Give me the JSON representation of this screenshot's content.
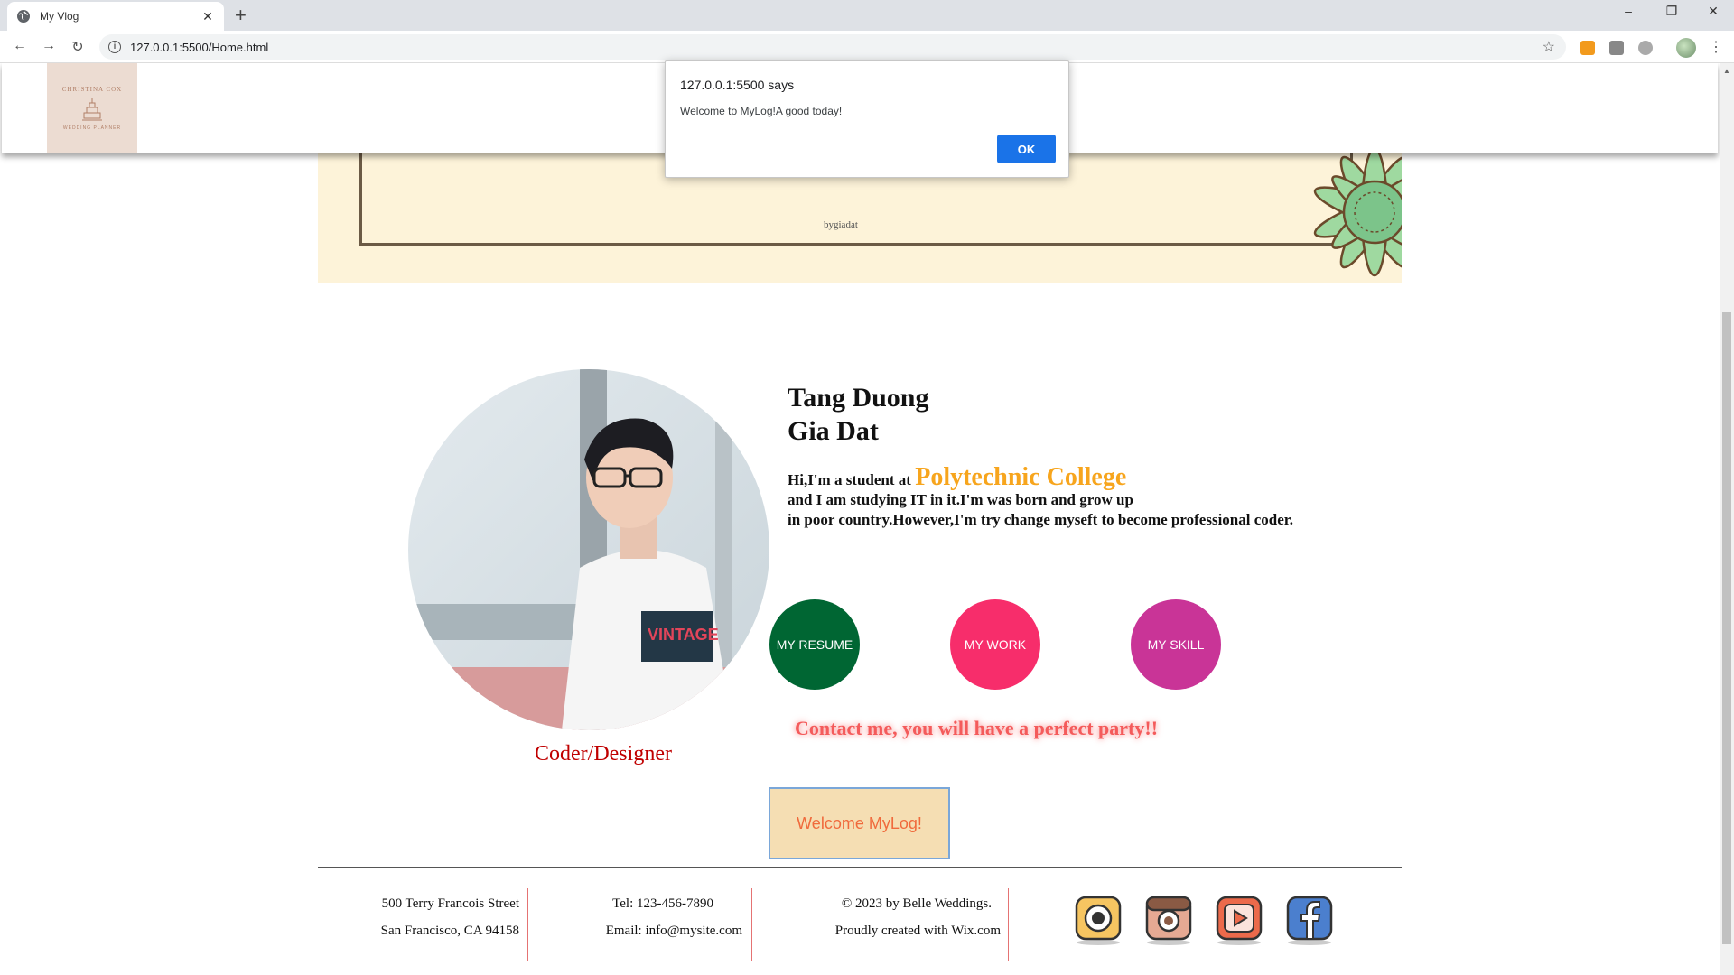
{
  "browser": {
    "tab_title": "My Vlog",
    "tab_close": "✕",
    "new_tab": "+",
    "url": "127.0.0.1:5500/Home.html",
    "window_controls": [
      "–",
      "❐",
      "✕"
    ]
  },
  "dialog": {
    "title": "127.0.0.1:5500 says",
    "message": "Welcome to MyLog!A good today!",
    "ok_label": "OK"
  },
  "header": {
    "logo": {
      "top": "CHRISTINA COX",
      "bottom": "WEDDING PLANNER"
    }
  },
  "banner": {
    "signature": "bygiadat"
  },
  "profile": {
    "name_line1": "Tang Duong",
    "name_line2": "Gia Dat",
    "role": "Coder/Designer",
    "bio_prefix": "Hi,I'm a student at ",
    "college": "Polytechnic College",
    "bio_line2": "and I am studying IT in it.I'm was born and grow up",
    "bio_line3": "in poor country.However,I'm try change myseft to become professional coder."
  },
  "buttons": [
    {
      "label": "MY RESUME",
      "color": "#006633"
    },
    {
      "label": "MY WORK",
      "color": "#f72d6b"
    },
    {
      "label": "MY SKILL",
      "color": "#c93497"
    }
  ],
  "contact_text": "Contact me, you will have a perfect party!!",
  "welcome_button": "Welcome MyLog!",
  "footer": {
    "address_line1": "500 Terry Francois Street",
    "address_line2": "San Francisco, CA 94158",
    "tel": "Tel: 123-456-7890",
    "email": "Email: info@mysite.com",
    "copyright": "© 2023 by Belle Weddings.",
    "created": "Proudly created with Wix.com"
  },
  "social_icons": [
    "camera-icon",
    "instagram-icon",
    "youtube-icon",
    "facebook-icon"
  ]
}
